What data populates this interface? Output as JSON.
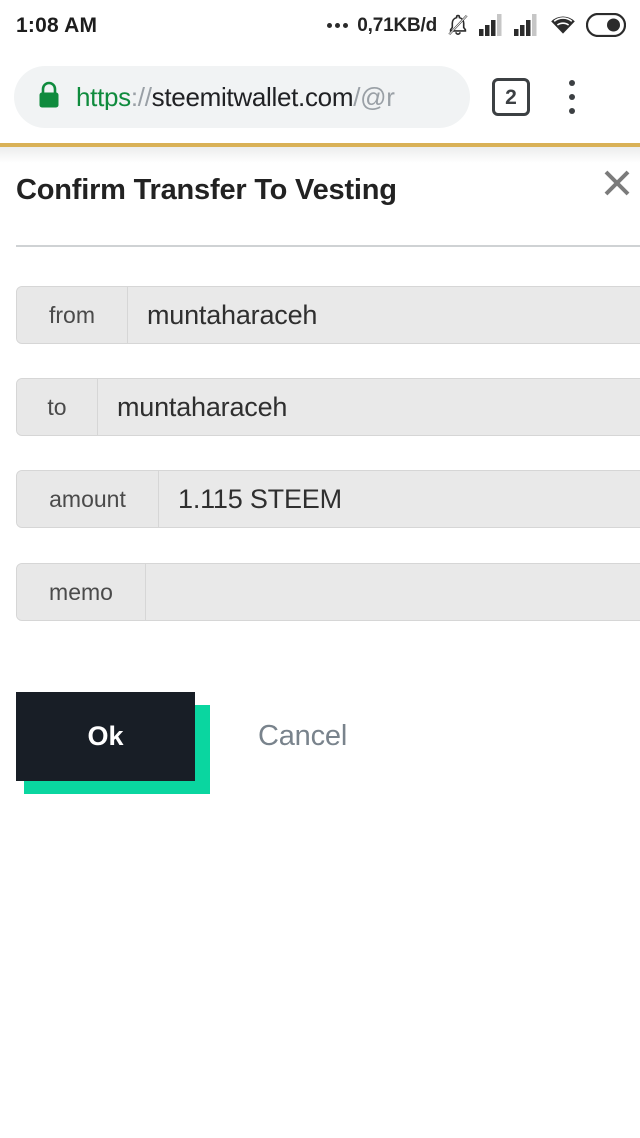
{
  "status_bar": {
    "clock": "1:08 AM",
    "data_rate": "0,71KB/d",
    "icons": [
      "more-dots-icon",
      "bell-muted-icon",
      "signal-bars-1-icon",
      "signal-bars-2-icon",
      "wifi-icon",
      "battery-icon"
    ]
  },
  "browser": {
    "lock_icon": "lock-icon",
    "url": {
      "scheme": "https",
      "separator": "://",
      "host": "steemitwallet.com",
      "path": "/@r"
    },
    "tab_count": "2",
    "overflow_icon": "more-vertical-icon"
  },
  "modal": {
    "title": "Confirm Transfer To Vesting",
    "close_icon": "close-icon",
    "fields": [
      {
        "label": "from",
        "value": "muntaharaceh"
      },
      {
        "label": "to",
        "value": "muntaharaceh"
      },
      {
        "label": "amount",
        "value": "1.115 STEEM"
      },
      {
        "label": "memo",
        "value": ""
      }
    ],
    "confirm_label": "Ok",
    "cancel_label": "Cancel"
  },
  "colors": {
    "accent_green": "#0ad6a0",
    "button_dark": "#181e26",
    "progress_gold": "#d9b157",
    "link_green": "#0f8b3d",
    "muted_text": "#79838c"
  }
}
